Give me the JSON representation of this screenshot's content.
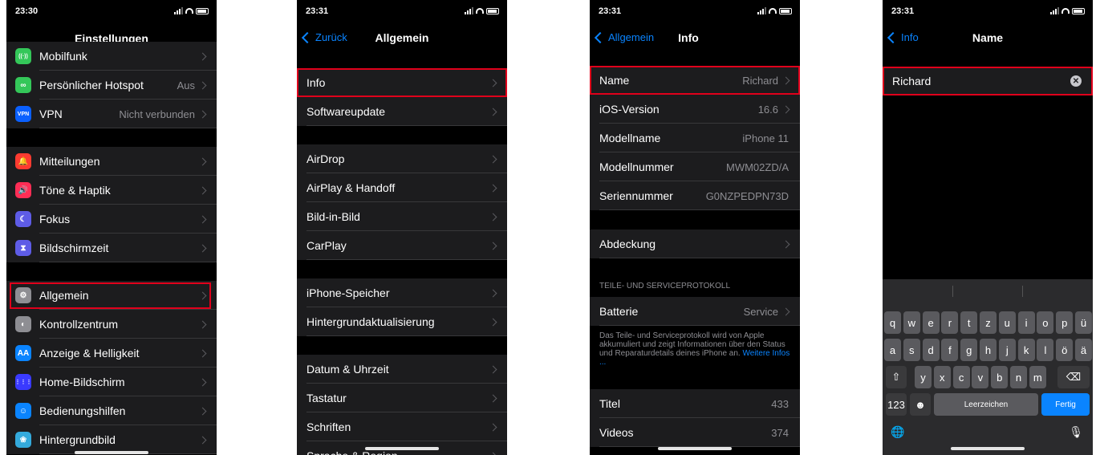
{
  "phones": [
    {
      "time": "23:30",
      "title": "Einstellungen",
      "rows": [
        {
          "label": "Mobilfunk",
          "value": "",
          "icon": "antenna-icon",
          "color": "#34c759",
          "glyph": "((·))"
        },
        {
          "label": "Persönlicher Hotspot",
          "value": "Aus",
          "icon": "hotspot-icon",
          "color": "#34c759",
          "glyph": "∞"
        },
        {
          "label": "VPN",
          "value": "Nicht verbunden",
          "icon": "vpn-icon",
          "color": "#0a60ff",
          "glyph": "VPN"
        },
        {
          "label": "Mitteilungen",
          "value": "",
          "icon": "notifications-icon",
          "color": "#ff3b30",
          "glyph": "🔔"
        },
        {
          "label": "Töne & Haptik",
          "value": "",
          "icon": "sounds-icon",
          "color": "#ff2d55",
          "glyph": "🔊"
        },
        {
          "label": "Fokus",
          "value": "",
          "icon": "moon-icon",
          "color": "#5e5ce6",
          "glyph": "☾"
        },
        {
          "label": "Bildschirmzeit",
          "value": "",
          "icon": "hourglass-icon",
          "color": "#5e5ce6",
          "glyph": "⧗"
        },
        {
          "label": "Allgemein",
          "value": "",
          "icon": "gear-icon",
          "color": "#8e8e93",
          "glyph": "⚙"
        },
        {
          "label": "Kontrollzentrum",
          "value": "",
          "icon": "toggles-icon",
          "color": "#8e8e93",
          "glyph": "◐"
        },
        {
          "label": "Anzeige & Helligkeit",
          "value": "",
          "icon": "display-icon",
          "color": "#0a84ff",
          "glyph": "AA"
        },
        {
          "label": "Home-Bildschirm",
          "value": "",
          "icon": "homescreen-icon",
          "color": "#3a3aff",
          "glyph": "⋮⋮⋮"
        },
        {
          "label": "Bedienungshilfen",
          "value": "",
          "icon": "accessibility-icon",
          "color": "#0a84ff",
          "glyph": "☺"
        },
        {
          "label": "Hintergrundbild",
          "value": "",
          "icon": "wallpaper-icon",
          "color": "#34aadc",
          "glyph": "❀"
        }
      ]
    },
    {
      "time": "23:31",
      "back": "Zurück",
      "title": "Allgemein",
      "rows": [
        {
          "label": "Info"
        },
        {
          "label": "Softwareupdate"
        },
        {
          "label": "AirDrop"
        },
        {
          "label": "AirPlay & Handoff"
        },
        {
          "label": "Bild-in-Bild"
        },
        {
          "label": "CarPlay"
        },
        {
          "label": "iPhone-Speicher"
        },
        {
          "label": "Hintergrundaktualisierung"
        },
        {
          "label": "Datum & Uhrzeit"
        },
        {
          "label": "Tastatur"
        },
        {
          "label": "Schriften"
        },
        {
          "label": "Sprache & Region"
        }
      ]
    },
    {
      "time": "23:31",
      "back": "Allgemein",
      "title": "Info",
      "rows": [
        {
          "label": "Name",
          "value": "Richard"
        },
        {
          "label": "iOS-Version",
          "value": "16.6"
        },
        {
          "label": "Modellname",
          "value": "iPhone 11"
        },
        {
          "label": "Modellnummer",
          "value": "MWM02ZD/A"
        },
        {
          "label": "Seriennummer",
          "value": "G0NZPEDPN73D"
        },
        {
          "label": "Abdeckung",
          "value": ""
        },
        {
          "label": "Batterie",
          "value": "Service"
        },
        {
          "label": "Titel",
          "value": "433"
        },
        {
          "label": "Videos",
          "value": "374"
        }
      ],
      "section_header": "TEILE- UND SERVICEPROTOKOLL",
      "footnote": "Das Teile- und Serviceprotokoll wird von Apple akkumuliert und zeigt Informationen über den Status und Reparaturdetails deines iPhone an.",
      "footnote_link": "Weitere Infos ..."
    },
    {
      "time": "23:31",
      "back": "Info",
      "title": "Name",
      "field_value": "Richard",
      "keyboard": {
        "row1": [
          "q",
          "w",
          "e",
          "r",
          "t",
          "z",
          "u",
          "i",
          "o",
          "p",
          "ü"
        ],
        "row2": [
          "a",
          "s",
          "d",
          "f",
          "g",
          "h",
          "j",
          "k",
          "l",
          "ö",
          "ä"
        ],
        "row3": [
          "y",
          "x",
          "c",
          "v",
          "b",
          "n",
          "m"
        ],
        "shift": "⇧",
        "delete": "⌫",
        "numbers": "123",
        "emoji": "☻",
        "space": "Leerzeichen",
        "done": "Fertig",
        "globe": "🌐",
        "mic": "🎙"
      }
    }
  ]
}
